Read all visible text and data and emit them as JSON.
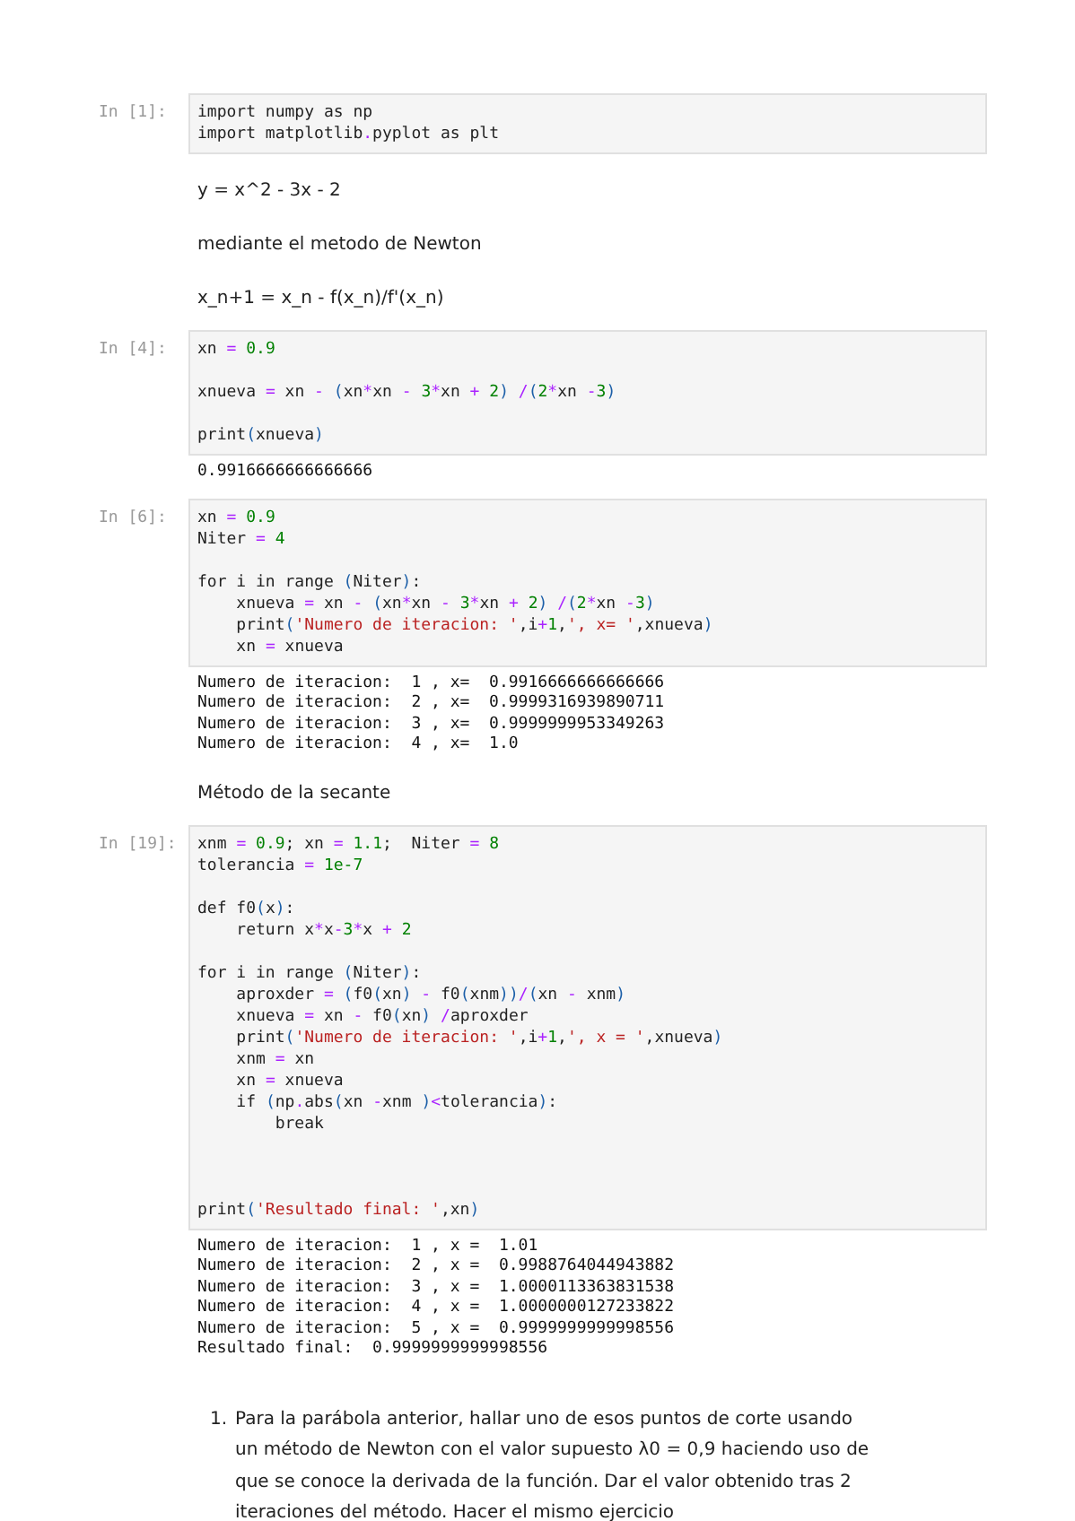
{
  "cells": [
    {
      "kind": "code",
      "prompt": "In [1]:",
      "lines": [
        {
          "kind": "code",
          "text": "import numpy as np"
        },
        {
          "kind": "code",
          "text": "import matplotlib.pyplot as plt"
        }
      ]
    },
    {
      "kind": "markdown",
      "text": "y = x^2 - 3x - 2"
    },
    {
      "kind": "markdown",
      "text": "mediante el metodo de Newton"
    },
    {
      "kind": "markdown",
      "text": "x_n+1 = x_n - f(x_n)/f'(x_n)"
    },
    {
      "kind": "code",
      "prompt": "In [4]:",
      "lines": [
        {
          "kind": "code",
          "text": "xn = 0.9"
        },
        {
          "kind": "blank"
        },
        {
          "kind": "code",
          "text": "xnueva = xn - (xn*xn - 3*xn + 2) /(2*xn -3)"
        },
        {
          "kind": "blank"
        },
        {
          "kind": "code",
          "text": "print(xnueva)"
        }
      ],
      "output": [
        "0.9916666666666666"
      ]
    },
    {
      "kind": "code",
      "prompt": "In [6]:",
      "lines": [
        {
          "kind": "code",
          "text": "xn = 0.9"
        },
        {
          "kind": "code",
          "text": "Niter = 4"
        },
        {
          "kind": "blank"
        },
        {
          "kind": "code",
          "text": "for i in range (Niter):"
        },
        {
          "kind": "code",
          "text": "    xnueva = xn - (xn*xn - 3*xn + 2) /(2*xn -3)"
        },
        {
          "kind": "code",
          "text": "    print('Numero de iteracion: ',i+1,', x= ',xnueva)"
        },
        {
          "kind": "code",
          "text": "    xn = xnueva"
        }
      ],
      "output": [
        "Numero de iteracion:  1 , x=  0.9916666666666666",
        "Numero de iteracion:  2 , x=  0.9999316939890711",
        "Numero de iteracion:  3 , x=  0.9999999953349263",
        "Numero de iteracion:  4 , x=  1.0"
      ]
    },
    {
      "kind": "markdown",
      "text": "Método de la secante"
    },
    {
      "kind": "code",
      "prompt": "In [19]:",
      "lines": [
        {
          "kind": "code",
          "text": "xnm = 0.9; xn = 1.1;  Niter = 8"
        },
        {
          "kind": "code",
          "text": "tolerancia = 1e-7"
        },
        {
          "kind": "blank"
        },
        {
          "kind": "code",
          "text": "def f0(x):"
        },
        {
          "kind": "code",
          "text": "    return x*x-3*x + 2"
        },
        {
          "kind": "blank"
        },
        {
          "kind": "code",
          "text": "for i in range (Niter):"
        },
        {
          "kind": "code",
          "text": "    aproxder = (f0(xn) - f0(xnm))/(xn - xnm)"
        },
        {
          "kind": "code",
          "text": "    xnueva = xn - f0(xn) /aproxder"
        },
        {
          "kind": "code",
          "text": "    print('Numero de iteracion: ',i+1,', x = ',xnueva)"
        },
        {
          "kind": "code",
          "text": "    xnm = xn"
        },
        {
          "kind": "code",
          "text": "    xn = xnueva"
        },
        {
          "kind": "code",
          "text": "    if (np.abs(xn -xnm )<tolerancia):"
        },
        {
          "kind": "code",
          "text": "        break"
        },
        {
          "kind": "blank"
        },
        {
          "kind": "blank"
        },
        {
          "kind": "blank"
        },
        {
          "kind": "code",
          "text": "print('Resultado final: ',xn)"
        }
      ],
      "output": [
        "Numero de iteracion:  1 , x =  1.01",
        "Numero de iteracion:  2 , x =  0.9988764044943882",
        "Numero de iteracion:  3 , x =  1.0000113363831538",
        "Numero de iteracion:  4 , x =  1.0000000127233822",
        "Numero de iteracion:  5 , x =  0.9999999999998556",
        "Resultado final:  0.9999999999998556"
      ]
    },
    {
      "kind": "list",
      "number": "1.",
      "text": "Para la parábola anterior, hallar uno de esos puntos de corte usando un método de Newton con el valor supuesto λ0 = 0,9 haciendo uso de que se conoce la derivada de la función. Dar el valor obtenido tras 2 iteraciones del método. Hacer el mismo ejercicio"
    }
  ]
}
